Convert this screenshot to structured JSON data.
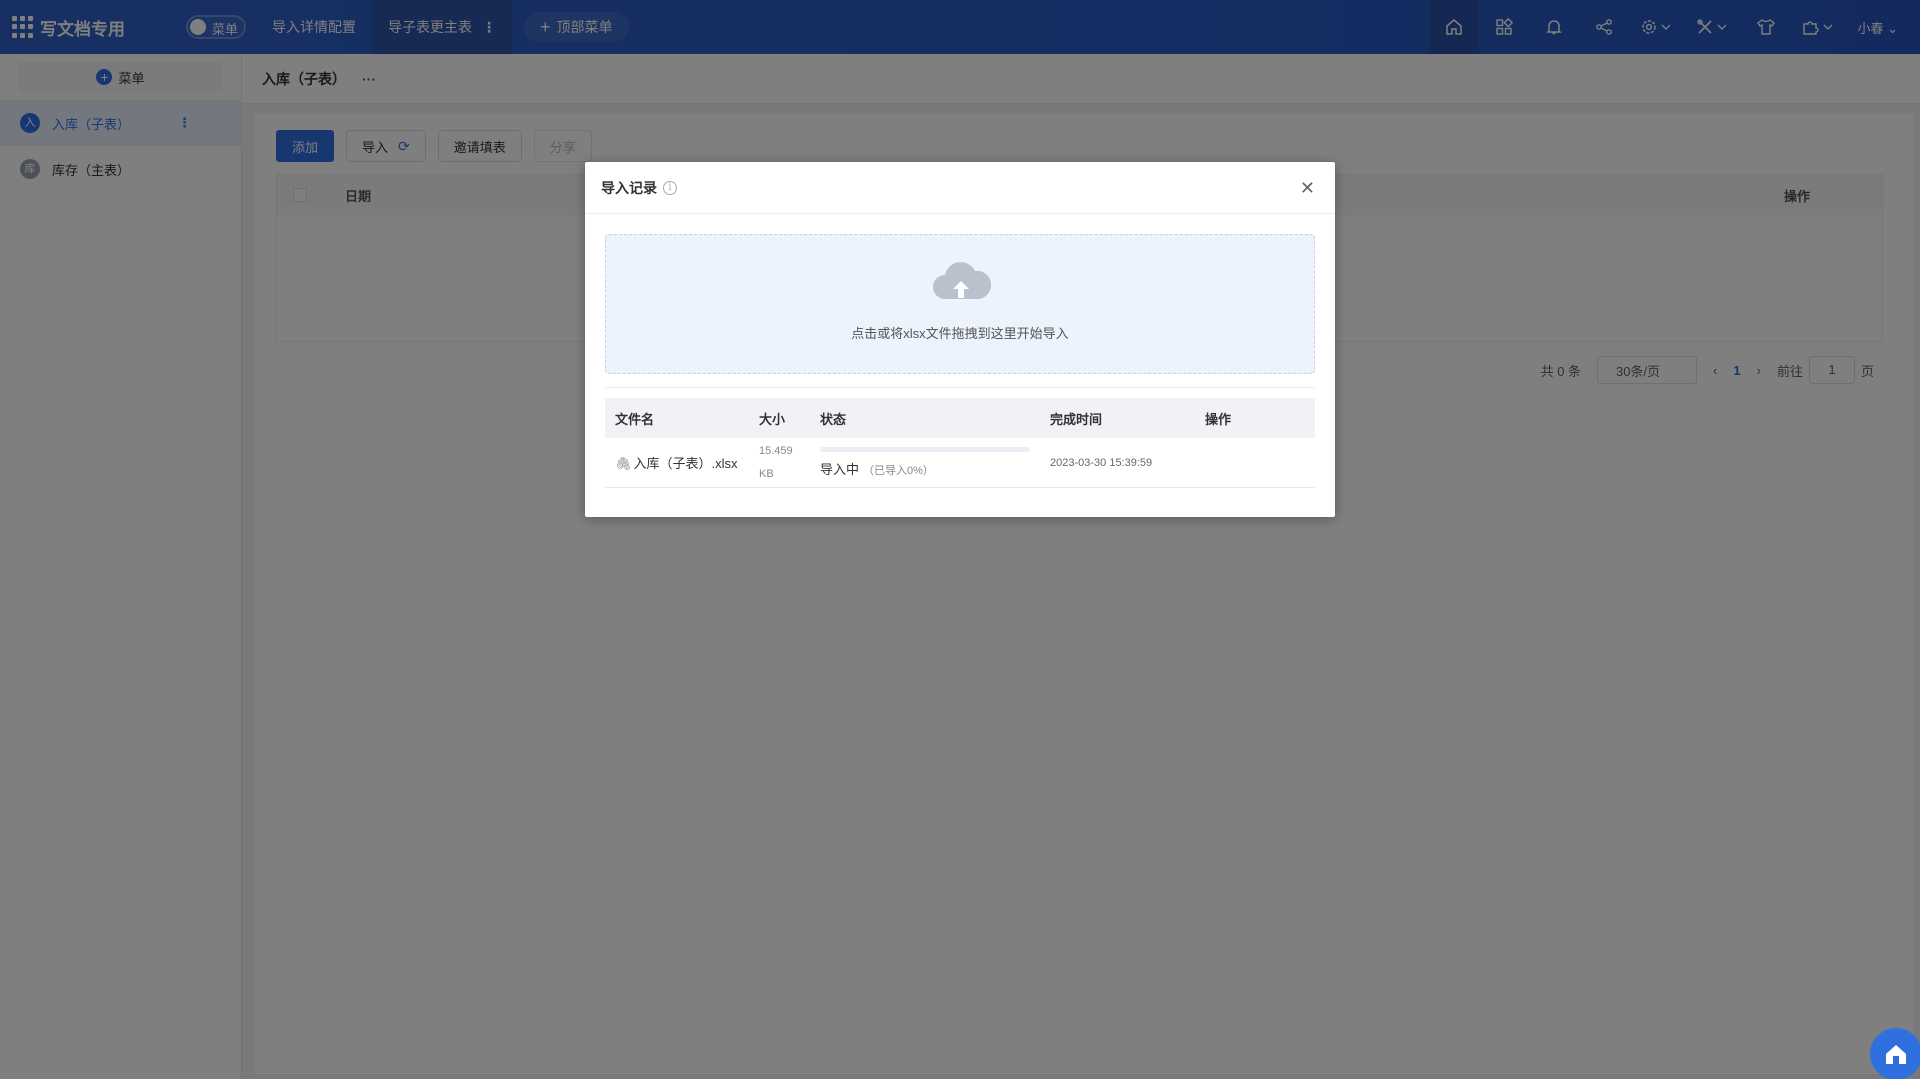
{
  "app": {
    "title": "写文档专用"
  },
  "topbar": {
    "menu_toggle_label": "菜单",
    "nav": [
      {
        "label": "导入详情配置"
      },
      {
        "label": "导子表更主表"
      }
    ],
    "add_menu_label": "顶部菜单",
    "user_label": "小春"
  },
  "sidebar": {
    "add_label": "菜单",
    "items": [
      {
        "avatar": "入",
        "label": "入库（子表）",
        "active": true
      },
      {
        "avatar": "库",
        "label": "库存（主表）",
        "active": false
      }
    ]
  },
  "breadcrumb": {
    "title": "入库（子表）",
    "more": "···"
  },
  "toolbar": {
    "add_label": "添加",
    "import_label": "导入",
    "invite_label": "邀请填表",
    "share_label": "分享"
  },
  "grid": {
    "columns": {
      "date": "日期",
      "ops": "操作"
    }
  },
  "pagination": {
    "total": "共 0 条",
    "page_size": "30条/页",
    "current": "1",
    "goto_prefix": "前往",
    "goto_value": "1",
    "goto_suffix": "页"
  },
  "dialog": {
    "title": "导入记录",
    "upload_hint": "点击或将xlsx文件拖拽到这里开始导入",
    "columns": {
      "filename": "文件名",
      "size": "大小",
      "status": "状态",
      "finish_time": "完成时间",
      "ops": "操作"
    },
    "rows": [
      {
        "filename": "入库（子表）.xlsx",
        "size_line1": "15.459",
        "size_line2": "KB",
        "status": "导入中",
        "status_detail": "（已导入0%）",
        "progress_percent": 0,
        "finish_time": "2023-03-30 15:39:59"
      }
    ]
  },
  "colors": {
    "accent": "#2f6fe0",
    "topbar": "#2a5bc4"
  }
}
